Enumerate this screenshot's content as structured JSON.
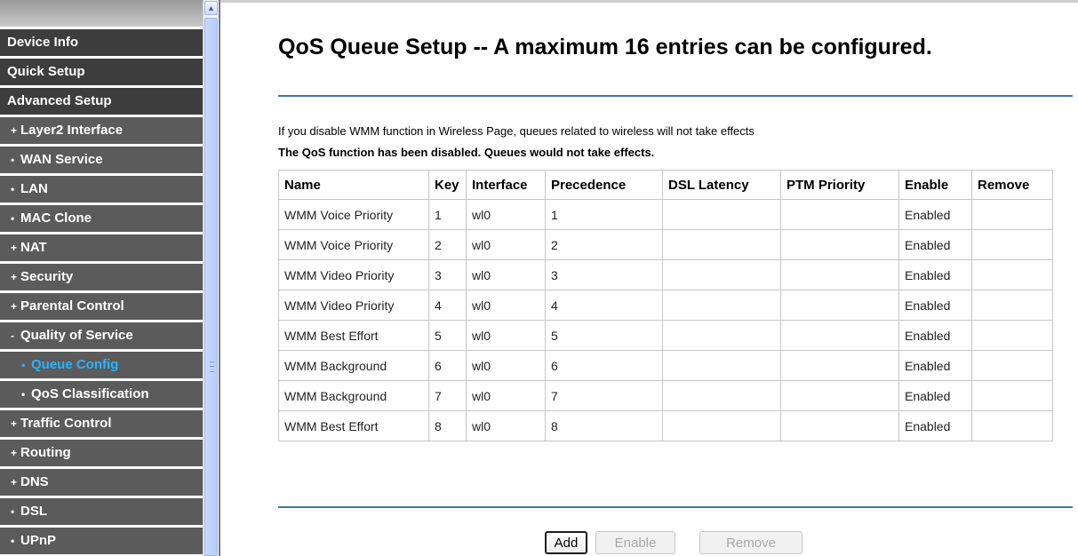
{
  "sidebar": {
    "items": [
      {
        "label": "Device Info",
        "level": 0,
        "bullet": ""
      },
      {
        "label": "Quick Setup",
        "level": 0,
        "bullet": ""
      },
      {
        "label": "Advanced Setup",
        "level": 0,
        "bullet": ""
      },
      {
        "label": "Layer2 Interface",
        "level": 1,
        "bullet": "+"
      },
      {
        "label": "WAN Service",
        "level": 1,
        "bullet": "•"
      },
      {
        "label": "LAN",
        "level": 1,
        "bullet": "•"
      },
      {
        "label": "MAC Clone",
        "level": 1,
        "bullet": "•"
      },
      {
        "label": "NAT",
        "level": 1,
        "bullet": "+"
      },
      {
        "label": "Security",
        "level": 1,
        "bullet": "+"
      },
      {
        "label": "Parental Control",
        "level": 1,
        "bullet": "+"
      },
      {
        "label": "Quality of Service",
        "level": 1,
        "bullet": "-"
      },
      {
        "label": "Queue Config",
        "level": 2,
        "bullet": "•",
        "active": true
      },
      {
        "label": "QoS Classification",
        "level": 2,
        "bullet": "•"
      },
      {
        "label": "Traffic Control",
        "level": 1,
        "bullet": "+"
      },
      {
        "label": "Routing",
        "level": 1,
        "bullet": "+"
      },
      {
        "label": "DNS",
        "level": 1,
        "bullet": "+"
      },
      {
        "label": "DSL",
        "level": 1,
        "bullet": "•"
      },
      {
        "label": "UPnP",
        "level": 1,
        "bullet": "•"
      }
    ],
    "scroll_up_glyph": "▲"
  },
  "main": {
    "title": "QoS Queue Setup -- A maximum 16 entries can be configured.",
    "note_wireless": "If you disable WMM function in Wireless Page, queues related to wireless will not take effects",
    "note_qos": "The QoS function has been disabled. Queues would not take effects.",
    "table": {
      "headers": [
        "Name",
        "Key",
        "Interface",
        "Precedence",
        "DSL Latency",
        "PTM Priority",
        "Enable",
        "Remove"
      ],
      "rows": [
        [
          "WMM Voice Priority",
          "1",
          "wl0",
          "1",
          "",
          "",
          "Enabled",
          ""
        ],
        [
          "WMM Voice Priority",
          "2",
          "wl0",
          "2",
          "",
          "",
          "Enabled",
          ""
        ],
        [
          "WMM Video Priority",
          "3",
          "wl0",
          "3",
          "",
          "",
          "Enabled",
          ""
        ],
        [
          "WMM Video Priority",
          "4",
          "wl0",
          "4",
          "",
          "",
          "Enabled",
          ""
        ],
        [
          "WMM Best Effort",
          "5",
          "wl0",
          "5",
          "",
          "",
          "Enabled",
          ""
        ],
        [
          "WMM Background",
          "6",
          "wl0",
          "6",
          "",
          "",
          "Enabled",
          ""
        ],
        [
          "WMM Background",
          "7",
          "wl0",
          "7",
          "",
          "",
          "Enabled",
          ""
        ],
        [
          "WMM Best Effort",
          "8",
          "wl0",
          "8",
          "",
          "",
          "Enabled",
          ""
        ]
      ]
    },
    "buttons": {
      "add": "Add",
      "enable": "Enable",
      "remove": "Remove"
    }
  },
  "colors": {
    "menu_bg": "#5b5b5b",
    "menu_text": "#ffffff",
    "menu_active_text": "#29b3ff",
    "rule": "#3c7aa0"
  }
}
